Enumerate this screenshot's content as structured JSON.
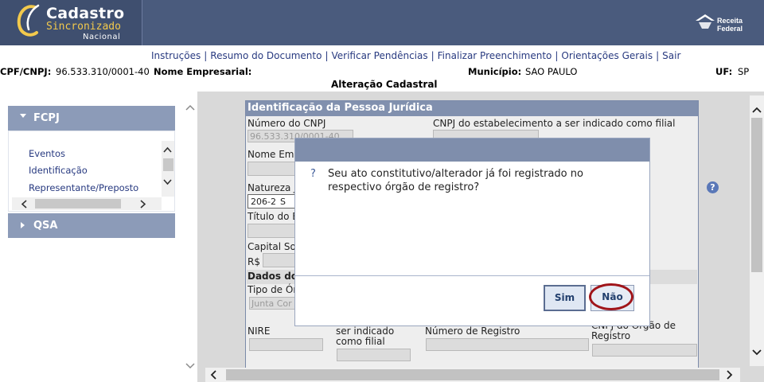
{
  "header": {
    "logo": {
      "line1": "Cadastro",
      "line2": "Sincronizado",
      "line3": "Nacional"
    },
    "brand_right": "Receita Federal"
  },
  "nav": {
    "links": [
      "Instruções",
      "Resumo do Documento",
      "Verificar Pendências",
      "Finalizar Preenchimento",
      "Orientações Gerais",
      "Sair"
    ],
    "separator": "|"
  },
  "info": {
    "cpf_label": "CPF/CNPJ:",
    "cpf_value": "96.533.310/0001-40",
    "nome_label": "Nome Empresarial:",
    "municipio_label": "Município:",
    "municipio_value": "SAO PAULO",
    "uf_label": "UF:",
    "uf_value": "SP",
    "page_subtitle": "Alteração Cadastral"
  },
  "left_panel": {
    "fcpj": {
      "label": "FCPJ",
      "items": [
        "Eventos",
        "Identificação",
        "Representante/Preposto"
      ]
    },
    "qsa": {
      "label": "QSA"
    }
  },
  "form": {
    "title": "Identificação da Pessoa Jurídica",
    "numero_cnpj_label": "Número do CNPJ",
    "numero_cnpj_value": "96.533.310/0001-40",
    "cnpj_filial_label": "CNPJ do estabelecimento a ser indicado como filial",
    "nome_emp_label": "Nome Emp",
    "natureza_label": "Natureza J",
    "natureza_value": "206-2",
    "natureza_value2": "S",
    "titulo_label": "Título do E",
    "capital_label": "Capital Soc",
    "currency": "R$",
    "dados_label": "Dados do",
    "tipo_label": "Tipo de Ór",
    "tipo_value": "Junta Cor",
    "nire_label": "NIRE",
    "filial_label_line1": "ser indicado",
    "filial_label_line2": "como filial",
    "numero_registro_label": "Número de Registro",
    "cnpj_orgao_line1": "CNPJ do Órgão de",
    "cnpj_orgao_line2": "Registro"
  },
  "dialog": {
    "icon": "?",
    "message": "Seu ato constitutivo/alterador já foi registrado no respectivo órgão de registro?",
    "yes_label": "Sim",
    "no_label": "Não",
    "highlight_color": "#a0151a"
  },
  "help_icon": "?",
  "icons": {
    "scroll_up": "chevron-up-icon",
    "scroll_down": "chevron-down-icon",
    "scroll_left": "chevron-left-icon",
    "scroll_right": "chevron-right-icon"
  }
}
